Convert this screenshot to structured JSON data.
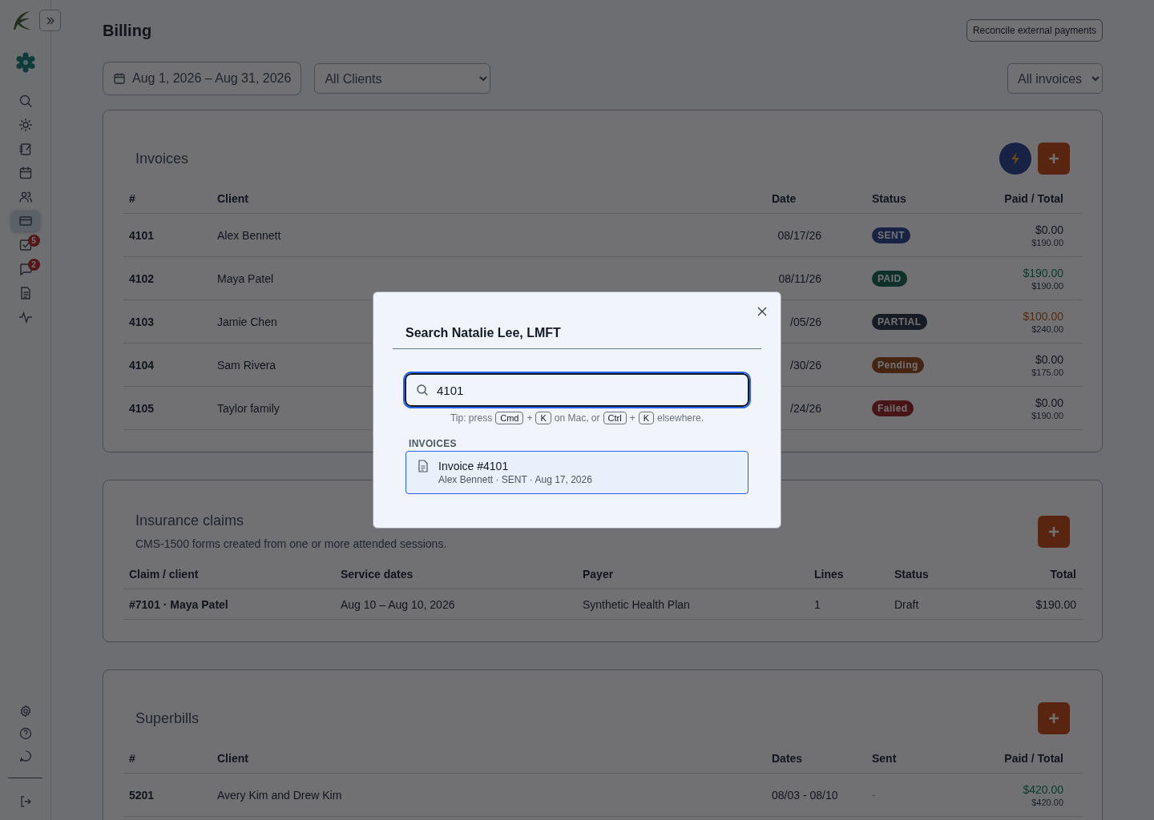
{
  "sidebar": {
    "items": [
      {
        "selected": false
      },
      {
        "selected": false
      },
      {
        "selected": false
      },
      {
        "selected": false
      },
      {
        "selected": false
      },
      {
        "selected": true
      },
      {
        "selected": false,
        "badge": "5"
      },
      {
        "selected": false,
        "badge": "2"
      },
      {
        "selected": false
      },
      {
        "selected": false
      }
    ],
    "footer_items": [
      {
        "selected": false
      },
      {
        "selected": false
      },
      {
        "selected": false
      }
    ]
  },
  "header": {
    "title": "Billing",
    "action": "Reconcile external payments"
  },
  "filters": {
    "date_range": "Aug 1, 2026 – Aug 31, 2026",
    "client": "All Clients",
    "invoice_filter": "All invoices"
  },
  "invoices": {
    "title": "Invoices",
    "columns": [
      "#",
      "Client",
      "Date",
      "Status",
      "Paid / Total"
    ],
    "rows": [
      {
        "number": "4101",
        "client": "Alex Bennett",
        "date": "08/17/26",
        "status": {
          "label": "SENT",
          "kind": "sent"
        },
        "paid": "$0.00",
        "total": "$190.00"
      },
      {
        "number": "4102",
        "client": "Maya Patel",
        "date": "08/11/26",
        "status": {
          "label": "PAID",
          "kind": "paid"
        },
        "paid": "$190.00",
        "total": "$190.00"
      },
      {
        "number": "4103",
        "client": "Jamie Chen",
        "date": "/05/26",
        "status": {
          "label": "PARTIAL",
          "kind": "partial"
        },
        "paid": "$100.00",
        "total": "$240.00"
      },
      {
        "number": "4104",
        "client": "Sam Rivera",
        "date": "/30/26",
        "status": {
          "label": "Pending",
          "kind": "pending"
        },
        "paid": "$0.00",
        "total": "$175.00"
      },
      {
        "number": "4105",
        "client": "Taylor family",
        "date": "/24/26",
        "status": {
          "label": "Failed",
          "kind": "failed"
        },
        "paid": "$0.00",
        "total": "$190.00"
      }
    ]
  },
  "claims": {
    "title": "Insurance claims",
    "subtitle": "CMS-1500 forms created from one or more attended sessions.",
    "columns": [
      "Claim / client",
      "Service dates",
      "Payer",
      "Lines",
      "Status",
      "Total"
    ],
    "rows": [
      {
        "claim": "#7101 · Maya Patel",
        "service_dates": "Aug 10 – Aug 10, 2026",
        "payer": "Synthetic Health Plan",
        "lines": "1",
        "status": "Draft",
        "total": "$190.00"
      }
    ]
  },
  "superbills": {
    "title": "Superbills",
    "columns": [
      "#",
      "Client",
      "Dates",
      "Sent",
      "Paid / Total"
    ],
    "rows": [
      {
        "number": "5201",
        "client": "Avery Kim and Drew Kim",
        "dates": "08/03 - 08/10",
        "sent": "-",
        "kind": "paid",
        "paid": "$420.00",
        "total": "$420.00"
      }
    ]
  },
  "search_dialog": {
    "title": "Search Natalie Lee, LMFT",
    "query": "4101",
    "tip": [
      {
        "kind": "text",
        "text": "Tip: press"
      },
      {
        "kind": "key",
        "text": "Cmd"
      },
      {
        "kind": "text",
        "text": "+"
      },
      {
        "kind": "key",
        "text": "K"
      },
      {
        "kind": "text",
        "text": "on Mac, or"
      },
      {
        "kind": "key",
        "text": "Ctrl"
      },
      {
        "kind": "text",
        "text": "+"
      },
      {
        "kind": "key",
        "text": "K"
      },
      {
        "kind": "text",
        "text": "elsewhere."
      }
    ],
    "section": "INVOICES",
    "results": [
      {
        "title": "Invoice #4101",
        "detail": "Alex Bennett · SENT · Aug 17, 2026",
        "selected": true
      }
    ]
  }
}
